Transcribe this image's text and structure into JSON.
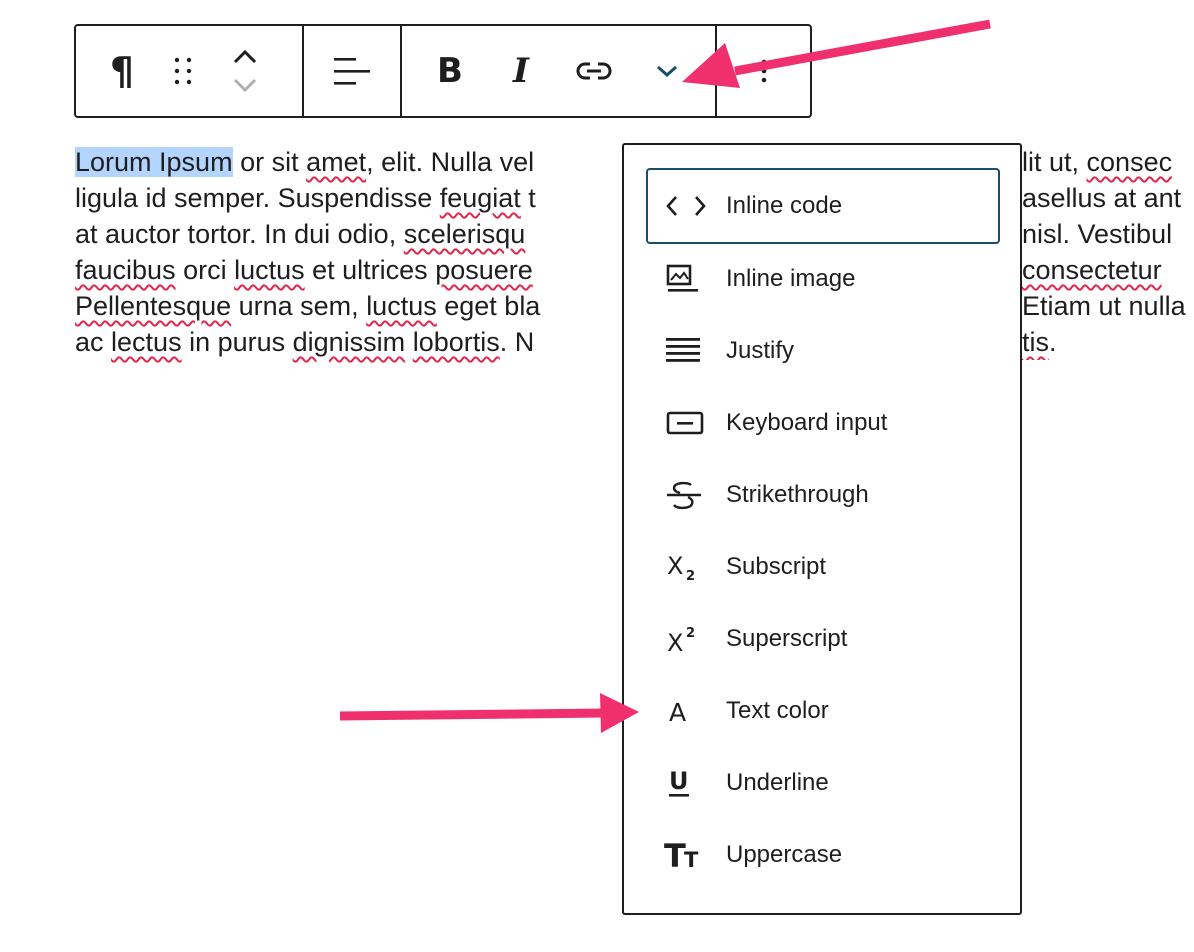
{
  "toolbar": {
    "paragraph_icon": "¶",
    "bold_label": "B",
    "italic_label": "I",
    "more_icon": "⋮"
  },
  "paragraph": {
    "selected": "Lorum Ipsum",
    "line1_rest_a": " or sit ",
    "line1_w1": "amet",
    "line1_rest_b": ", elit. Nulla vel",
    "line1_tail": "lit ut, ",
    "line1_w2": "consec",
    "line2_a": "ligula id semper. Suspendisse ",
    "line2_w1": "feugiat",
    "line2_b": " t",
    "line2_tail": "asellus at ant",
    "line3_a": "at auctor tortor. In dui odio, ",
    "line3_w1": "scelerisqu",
    "line3_tail": "nisl. Vestibul",
    "line4_w1": "faucibus",
    "line4_a": " orci ",
    "line4_w2": "luctus",
    "line4_b": " et ultrices ",
    "line4_w3": "posuere",
    "line4_tail_w": "consectetur",
    "line5_w1": "Pellentesque",
    "line5_a": " urna sem, ",
    "line5_w2": "luctus",
    "line5_b": " eget ",
    "line5_w3": "bla",
    "line5_tail": "Etiam ut nulla",
    "line6_a": "ac ",
    "line6_w1": "lectus",
    "line6_b": " in purus ",
    "line6_w2": "dignissim",
    "line6_c": " ",
    "line6_w3": "lobortis",
    "line6_d": ". N",
    "line6_tail_w": "tis",
    "line6_tail_end": "."
  },
  "menu": {
    "items": [
      {
        "label": "Inline code",
        "icon": "code-icon"
      },
      {
        "label": "Inline image",
        "icon": "image-icon"
      },
      {
        "label": "Justify",
        "icon": "justify-icon"
      },
      {
        "label": "Keyboard input",
        "icon": "keyboard-icon"
      },
      {
        "label": "Strikethrough",
        "icon": "strikethrough-icon"
      },
      {
        "label": "Subscript",
        "icon": "subscript-icon"
      },
      {
        "label": "Superscript",
        "icon": "superscript-icon"
      },
      {
        "label": "Text color",
        "icon": "text-color-icon"
      },
      {
        "label": "Underline",
        "icon": "underline-icon"
      },
      {
        "label": "Uppercase",
        "icon": "uppercase-icon"
      }
    ]
  },
  "colors": {
    "annotation_arrow": "#f0306e",
    "focus_border": "#1a4d69",
    "selection": "#b3d4fc",
    "spell_underline": "#e2264d"
  }
}
